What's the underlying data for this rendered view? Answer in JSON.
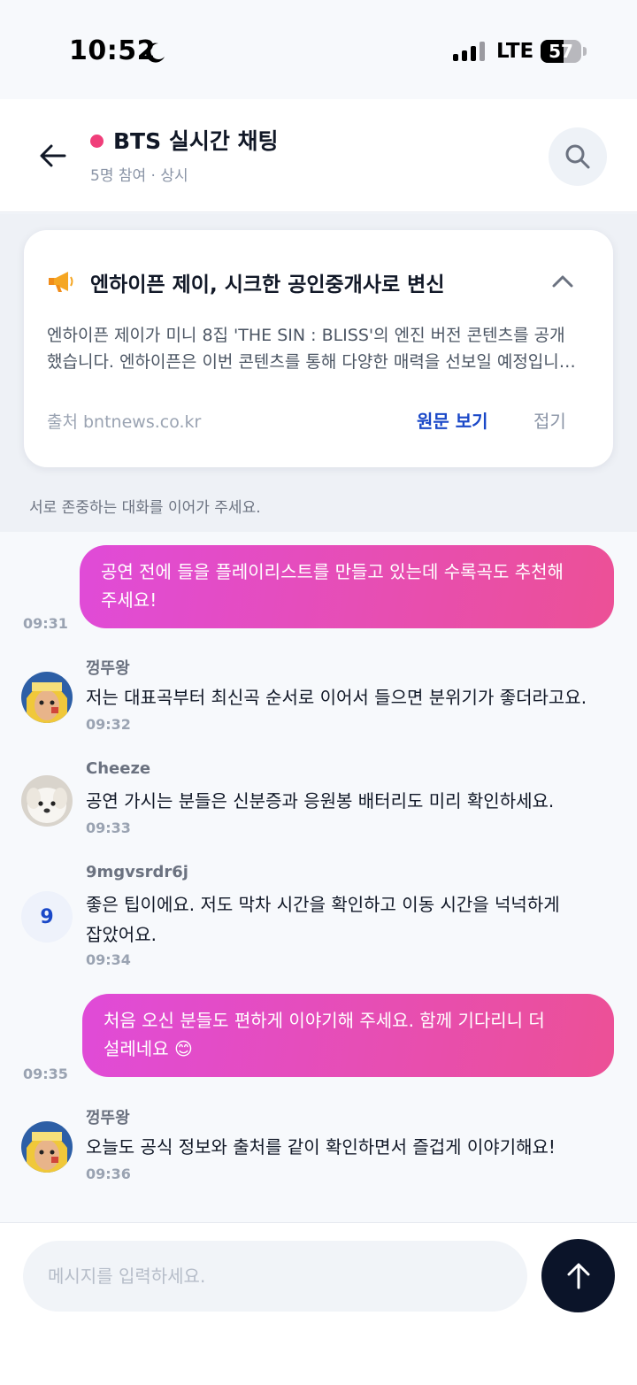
{
  "status_bar": {
    "time": "10:52",
    "network": "LTE",
    "battery": "57",
    "battery_level": 0.57,
    "icons": [
      "moon-icon",
      "signal-icon",
      "battery-icon"
    ]
  },
  "header": {
    "title": "BTS 실시간 채팅",
    "subtitle": "5명 참여 · 상시",
    "live_color": "#f03e7a",
    "icons": [
      "back-arrow-icon",
      "search-icon"
    ]
  },
  "notice": {
    "icon": "megaphone-icon",
    "title": "엔하이픈 제이, 시크한 공인중개사로 변신",
    "body_line1": "엔하이픈 제이가 미니 8집 'THE SIN : BLISS'의 엔진 버전 콘텐츠를 공개",
    "body_line2": "했습니다. 엔하이픈은 이번 콘텐츠를 통해 다양한 매력을 선보일 예정입니…",
    "source": "출처 bntnews.co.kr",
    "link_label": "원문 보기",
    "fold_label": "접기",
    "footer": "서로 존중하는 대화를 이어가 주세요."
  },
  "messages": [
    {
      "type": "out",
      "text": "공연 전에 들을 플레이리스트를 만들고 있는데 수록곡도 추천해 주세요!",
      "time": "09:31"
    },
    {
      "type": "in",
      "sender": "껑뚜왕",
      "avatar": "anime-avatar",
      "text": "저는 대표곡부터 최신곡 순서로 이어서 들으면 분위기가 좋더라고요.",
      "time": "09:32"
    },
    {
      "type": "in",
      "sender": "Cheeze",
      "avatar": "dog-avatar",
      "text": "공연 가시는 분들은 신분증과 응원봉 배터리도 미리 확인하세요.",
      "time": "09:33"
    },
    {
      "type": "in",
      "sender": "9mgvsrdr6j",
      "avatar_letter": "9",
      "text": "좋은 팁이에요. 저도 막차 시간을 확인하고 이동 시간을 넉넉하게 잡았어요.",
      "time": "09:34"
    },
    {
      "type": "out",
      "text": "처음 오신 분들도 편하게 이야기해 주세요. 함께 기다리니 더 설레네요 😊",
      "time": "09:35"
    },
    {
      "type": "in",
      "sender": "껑뚜왕",
      "avatar": "anime-avatar",
      "text": "오늘도 공식 정보와 출처를 같이 확인하면서 즐겁게 이야기해요!",
      "time": "09:36"
    }
  ],
  "composer": {
    "placeholder": "메시지를 입력하세요.",
    "send_icon": "arrow-up-icon"
  },
  "colors": {
    "bubble_start": "#e04bd8",
    "bubble_end": "#ec5096",
    "link": "#1a48c8",
    "send_button": "#0b1429"
  }
}
